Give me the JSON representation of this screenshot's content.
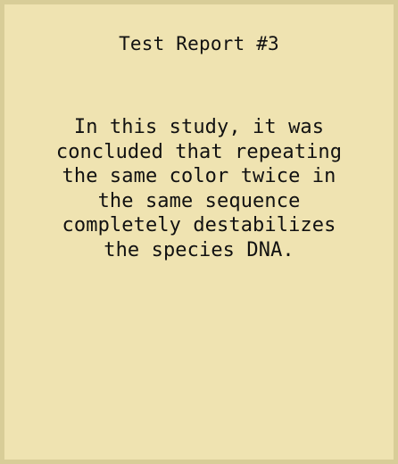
{
  "report": {
    "title": "Test Report #3",
    "lines": [
      "In this study, it was",
      "concluded that repeating",
      "the same color twice in",
      "the same sequence",
      "completely destabilizes",
      "the species DNA."
    ]
  },
  "colors": {
    "paper": "#efe3b1",
    "border": "#d8cd98",
    "text": "#111111"
  }
}
